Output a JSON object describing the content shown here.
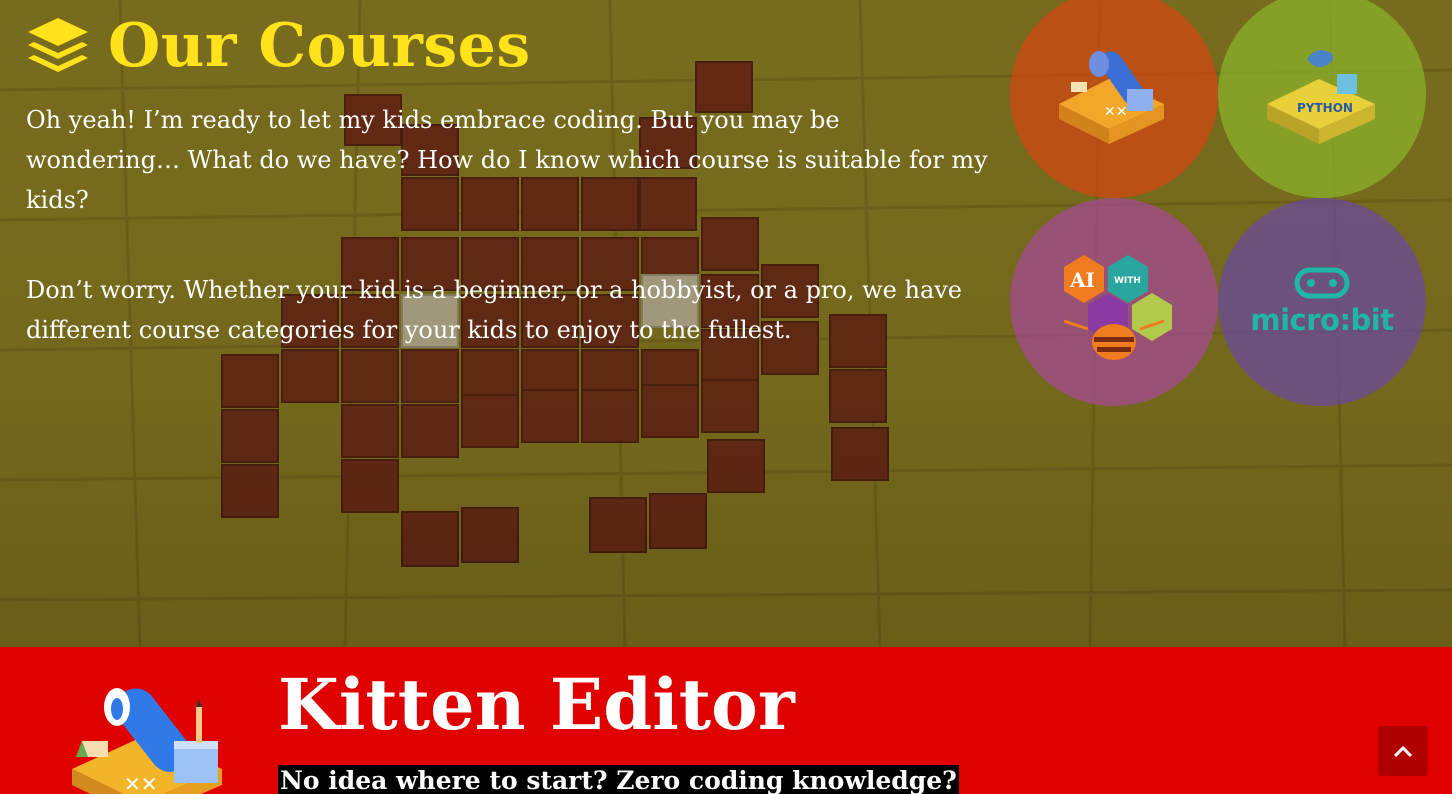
{
  "hero": {
    "title": "Our Courses",
    "paragraphs": [
      "Oh yeah! I’m ready to let my kids embrace coding. But you may be wondering… What do we have? How do I know which course is suitable for my kids?",
      "Don’t worry. Whether your kid is a beginner, or a hobbyist, or a pro, we have different course categories for your kids to enjoy to the fullest."
    ],
    "title_icon": "layers-icon"
  },
  "course_circles": [
    {
      "name": "kitten",
      "color": "#d64610",
      "icon": "kitten-editor-icon"
    },
    {
      "name": "python",
      "color": "#8ab628",
      "icon": "python-icon"
    },
    {
      "name": "ai",
      "color": "#a84a96",
      "icon": "ai-with-bee-icon",
      "logo_text": "AI",
      "logo_subtext": "WITH"
    },
    {
      "name": "microbit",
      "color": "#6a4aa0",
      "icon": "microbit-icon",
      "logo_text": "micro:bit"
    }
  ],
  "featured": {
    "title": "Kitten Editor",
    "subtitle": "No idea where to start? Zero coding knowledge?",
    "icon": "kitten-editor-icon"
  },
  "scroll_top": {
    "icon": "chevron-up-icon"
  },
  "colors": {
    "title_yellow": "#ffe21a",
    "section_red": "#e00000",
    "button_red": "#b10000",
    "microbit_teal": "#1eb7a7"
  }
}
